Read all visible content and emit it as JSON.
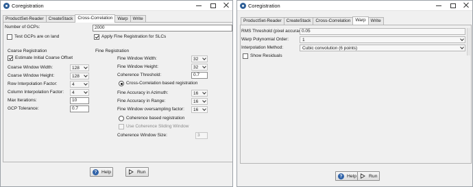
{
  "left": {
    "title": "Coregistration",
    "tabs": [
      "ProductSet-Reader",
      "CreateStack",
      "Cross-Correlation",
      "Warp",
      "Write"
    ],
    "active_tab": "Cross-Correlation",
    "num_gcps_label": "Number of GCPs:",
    "num_gcps_value": "2000",
    "test_gcps_label": "Test GCPs are on land",
    "apply_fine_label": "Apply Fine Registration for SLCs",
    "coarse": {
      "title": "Coarse Registration",
      "estimate_label": "Estimate Initial Coarse Offset",
      "window_width_label": "Coarse Window Width:",
      "window_width_value": "128",
      "window_height_label": "Coarse Window Height:",
      "window_height_value": "128",
      "row_interp_label": "Row Interpolation Factor:",
      "row_interp_value": "4",
      "col_interp_label": "Column Interpolation Factor:",
      "col_interp_value": "4",
      "max_iter_label": "Max Iterations:",
      "max_iter_value": "10",
      "gcp_tol_label": "GCP Tolerance:",
      "gcp_tol_value": "0.7"
    },
    "fine": {
      "title": "Fine Registration",
      "window_width_label": "Fine Window Width:",
      "window_width_value": "32",
      "window_height_label": "Fine Window Height:",
      "window_height_value": "32",
      "coh_thresh_label": "Coherence Threshold:",
      "coh_thresh_value": "0.7",
      "cc_based_label": "Cross-Correlation based registration",
      "acc_azimuth_label": "Fine Accuracy in Azimuth:",
      "acc_azimuth_value": "16",
      "acc_range_label": "Fine Accuracy in Range:",
      "acc_range_value": "16",
      "oversampling_label": "Fine Window oversampling factor:",
      "oversampling_value": "16",
      "coh_based_label": "Coherence based registration",
      "sliding_label": "Use Coherence Sliding Window",
      "coh_window_label": "Coherence Window Size:",
      "coh_window_value": "3"
    },
    "help_label": "Help",
    "run_label": "Run"
  },
  "right": {
    "title": "Coregistration",
    "tabs": [
      "ProductSet-Reader",
      "CreateStack",
      "Cross-Correlation",
      "Warp",
      "Write"
    ],
    "active_tab": "Warp",
    "rms_label": "RMS Threshold (pixel accuracy):",
    "rms_value": "0.05",
    "poly_label": "Warp Polynomial Order:",
    "poly_value": "1",
    "interp_label": "Interpolation Method:",
    "interp_value": "Cubic convolution (6 points)",
    "show_resid_label": "Show Residuals",
    "help_label": "Help",
    "run_label": "Run"
  },
  "colors": {
    "help_icon": "#2f62a8",
    "app_icon": "#2e5f97",
    "panel_bg": "#f0f0f0"
  }
}
